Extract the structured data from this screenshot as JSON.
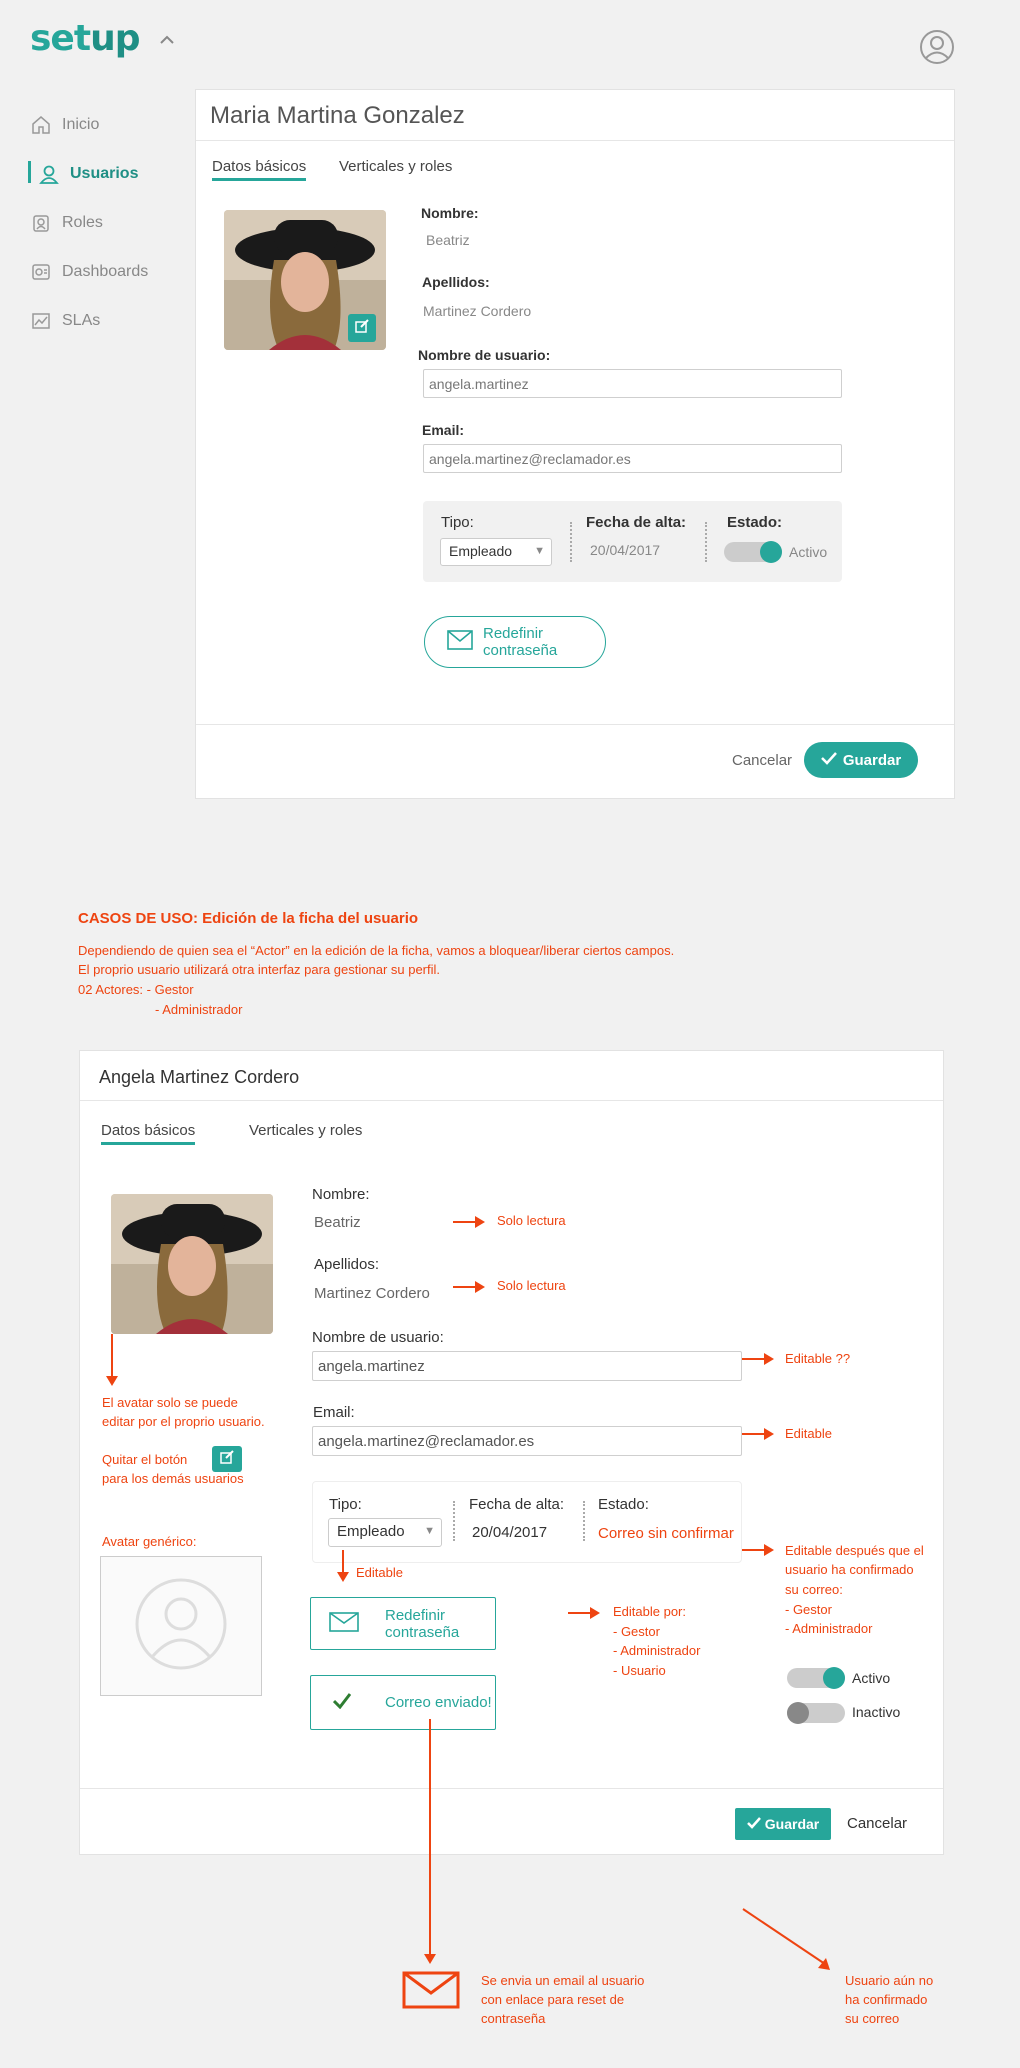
{
  "app": {
    "logo_a": "set",
    "logo_b": "up"
  },
  "nav": {
    "items": [
      {
        "label": "Inicio",
        "icon": "home-icon"
      },
      {
        "label": "Usuarios",
        "icon": "user-icon",
        "active": true
      },
      {
        "label": "Roles",
        "icon": "roles-icon"
      },
      {
        "label": "Dashboards",
        "icon": "dashboard-icon"
      },
      {
        "label": "SLAs",
        "icon": "chart-icon"
      }
    ]
  },
  "card1": {
    "title": "Maria Martina Gonzalez",
    "tabs": [
      "Datos básicos",
      "Verticales y roles"
    ],
    "nombre_label": "Nombre:",
    "nombre_value": "Beatriz",
    "apellidos_label": "Apellidos:",
    "apellidos_value": "Martinez Cordero",
    "username_label": "Nombre de usuario:",
    "username_value": "angela.martinez",
    "email_label": "Email:",
    "email_value": "angela.martinez@reclamador.es",
    "tipo_label": "Tipo:",
    "tipo_value": "Empleado",
    "fecha_label": "Fecha de alta:",
    "fecha_value": "20/04/2017",
    "estado_label": "Estado:",
    "estado_value": "Activo",
    "reset_button": "Redefinir contraseña",
    "cancel": "Cancelar",
    "save": "Guardar"
  },
  "usecase": {
    "heading": "CASOS DE USO: Edición de la ficha del usuario",
    "line1": "Dependiendo de quien sea el “Actor” en la edición de la ficha, vamos a bloquear/liberar ciertos campos.",
    "line2": "El proprio usuario utilizará otra interfaz para gestionar su perfil.",
    "line3": "02 Actores: - Gestor",
    "line4": "- Administrador"
  },
  "card2": {
    "title": "Angela Martinez Cordero",
    "tabs": [
      "Datos básicos",
      "Verticales y roles"
    ],
    "nombre_label": "Nombre:",
    "nombre_value": "Beatriz",
    "apellidos_label": "Apellidos:",
    "apellidos_value": "Martinez Cordero",
    "username_label": "Nombre de usuario:",
    "username_value": "angela.martinez",
    "email_label": "Email:",
    "email_value": "angela.martinez@reclamador.es",
    "tipo_label": "Tipo:",
    "tipo_value": "Empleado",
    "fecha_label": "Fecha de alta:",
    "fecha_value": "20/04/2017",
    "estado_label": "Estado:",
    "estado_value": "Correo sin confirmar",
    "reset_button": "Redefinir contraseña",
    "sent_button": "Correo enviado!",
    "save": "Guardar",
    "cancel": "Cancelar",
    "activo": "Activo",
    "inactivo": "Inactivo"
  },
  "notes": {
    "solo1": "Solo lectura",
    "solo2": "Solo lectura",
    "edit_q": "Editable ??",
    "edit_email": "Editable",
    "avatar1": "El avatar solo se puede",
    "avatar2": "editar por el proprio usuario.",
    "quitar1": "Quitar el botón",
    "quitar2": "para los demás usuarios",
    "avatar_gen": "Avatar genérico:",
    "tipo_edit": "Editable",
    "estado1": "Editable después que el",
    "estado2": "usuario ha confirmado",
    "estado3": "su correo:",
    "estado4": "- Gestor",
    "estado5": "- Administrador",
    "reset1": "Editable por:",
    "reset2": "- Gestor",
    "reset3": "- Administrador",
    "reset4": "- Usuario",
    "mail1": "Se envia un email al usuario",
    "mail2": "con enlace para reset de",
    "mail3": "contraseña",
    "unconf1": "Usuario aún no",
    "unconf2": "ha confirmado",
    "unconf3": "su correo"
  },
  "colors": {
    "accent": "#26a69a",
    "annotation": "#ee4411"
  }
}
